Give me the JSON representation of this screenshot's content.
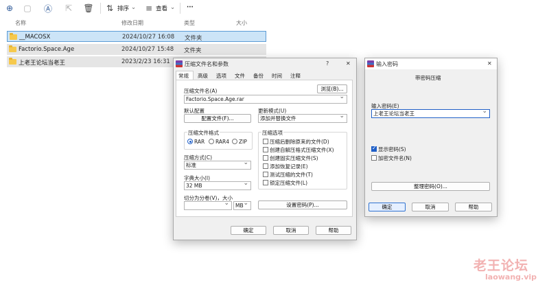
{
  "toolbar": {
    "sort_label": "排序",
    "view_label": "查看",
    "more_label": "···"
  },
  "columns": {
    "name": "名称",
    "date": "修改日期",
    "type": "类型",
    "size": "大小"
  },
  "files": [
    {
      "name": "__MACOSX",
      "date": "2024/10/27 16:08",
      "type": "文件夹"
    },
    {
      "name": "Factorio.Space.Age",
      "date": "2024/10/27 15:48",
      "type": "文件夹"
    },
    {
      "name": "上老王论坛当老王",
      "date": "2023/2/23 16:31",
      "type": ""
    }
  ],
  "archive_dialog": {
    "title": "压缩文件名和参数",
    "help": "?",
    "close": "✕",
    "tabs": [
      "常规",
      "高级",
      "选项",
      "文件",
      "备份",
      "时间",
      "注释"
    ],
    "archive_name_label": "压缩文件名(A)",
    "browse_button": "浏览(B)...",
    "archive_name_value": "Factorio.Space.Age.rar",
    "default_profile_label": "默认配置",
    "profile_button": "配置文件(F)...",
    "update_mode_label": "更新模式(U)",
    "update_mode_value": "添加并替换文件",
    "format_label": "压缩文件格式",
    "formats": [
      "RAR",
      "RAR4",
      "ZIP"
    ],
    "method_label": "压缩方式(C)",
    "method_value": "标准",
    "dict_label": "字典大小(I)",
    "dict_value": "32 MB",
    "split_label": "切分为分卷(V)，大小",
    "split_unit": "MB",
    "options_label": "压缩选项",
    "options": [
      "压缩后删除原来的文件(D)",
      "创建自解压格式压缩文件(X)",
      "创建固实压缩文件(S)",
      "添加恢复记录(E)",
      "测试压缩的文件(T)",
      "锁定压缩文件(L)"
    ],
    "set_password_button": "设置密码(P)...",
    "ok_button": "确定",
    "cancel_button": "取消",
    "help_button": "帮助"
  },
  "password_dialog": {
    "title": "输入密码",
    "close": "✕",
    "heading": "带密码压缩",
    "password_label": "输入密码(E)",
    "password_value": "上老王论坛当老王",
    "show_password_label": "显示密码(S)",
    "encrypt_names_label": "加密文件名(N)",
    "organize_button": "整理密码(O)...",
    "ok_button": "确定",
    "cancel_button": "取消",
    "help_button": "帮助"
  },
  "watermark": {
    "line1": "老王论坛",
    "line2": "laowang.vip"
  },
  "colors": {
    "selection": "#cce4f7",
    "row_hover": "#e5e5e5",
    "accent": "#1f5fc7"
  }
}
